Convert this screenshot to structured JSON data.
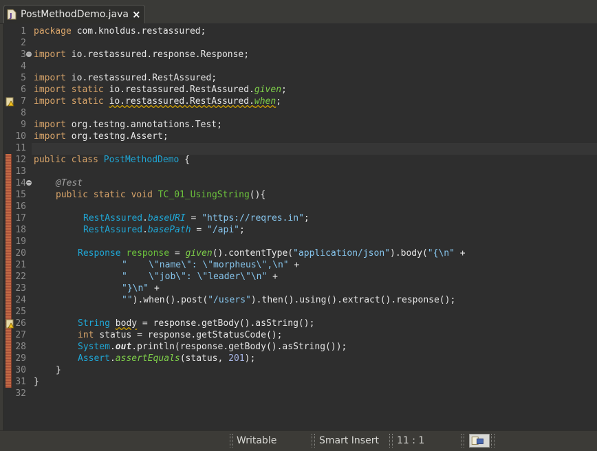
{
  "tab": {
    "title": "PostMethodDemo.java",
    "close": "×",
    "icon": "java-file-icon"
  },
  "editor": {
    "lines": [
      {
        "n": "1"
      },
      {
        "n": "2"
      },
      {
        "n": "3"
      },
      {
        "n": "4"
      },
      {
        "n": "5"
      },
      {
        "n": "6"
      },
      {
        "n": "7"
      },
      {
        "n": "8"
      },
      {
        "n": "9"
      },
      {
        "n": "10"
      },
      {
        "n": "11"
      },
      {
        "n": "12"
      },
      {
        "n": "13"
      },
      {
        "n": "14"
      },
      {
        "n": "15"
      },
      {
        "n": "16"
      },
      {
        "n": "17"
      },
      {
        "n": "18"
      },
      {
        "n": "19"
      },
      {
        "n": "20"
      },
      {
        "n": "21"
      },
      {
        "n": "22"
      },
      {
        "n": "23"
      },
      {
        "n": "24"
      },
      {
        "n": "25"
      },
      {
        "n": "26"
      },
      {
        "n": "27"
      },
      {
        "n": "28"
      },
      {
        "n": "29"
      },
      {
        "n": "30"
      },
      {
        "n": "31"
      },
      {
        "n": "32"
      }
    ],
    "code": {
      "l1_kw": "package",
      "l1_rest": " com.knoldus.restassured;",
      "l3_kw": "import",
      "l3_rest": " io.restassured.response.Response;",
      "l5_kw": "import",
      "l5_rest": " io.restassured.RestAssured;",
      "l6_kw": "import static",
      "l6_rest": " io.restassured.RestAssured.",
      "l6_m": "given",
      "l6_end": ";",
      "l7_kw": "import static",
      "l7_sp": " ",
      "l7_rest": "io.restassured.RestAssured.",
      "l7_m": "when",
      "l7_end": ";",
      "l9_kw": "import",
      "l9_rest": " org.testng.annotations.Test;",
      "l10_kw": "import",
      "l10_rest": " org.testng.Assert;",
      "l12_kw": "public class",
      "l12_sp": " ",
      "l12_cls": "PostMethodDemo",
      "l12_end": " {",
      "l14_ann": "@Test",
      "l15_kw": "public static void",
      "l15_sp": " ",
      "l15_m": "TC_01_UsingString",
      "l15_end": "(){",
      "l17_cls": "RestAssured",
      "l17_dot": ".",
      "l17_f": "baseURI",
      "l17_eq": " = ",
      "l17_str": "\"https://reqres.in\"",
      "l17_end": ";",
      "l18_cls": "RestAssured",
      "l18_dot": ".",
      "l18_f": "basePath",
      "l18_eq": " = ",
      "l18_str": "\"/api\"",
      "l18_end": ";",
      "l20_cls": "Response",
      "l20_sp": " ",
      "l20_var": "response",
      "l20_eq": " = ",
      "l20_m": "given",
      "l20_a": "().contentType(",
      "l20_s1": "\"application/json\"",
      "l20_b": ").body(",
      "l20_s2": "\"{\\n\"",
      "l20_end": " +",
      "l21_str": "\"    \\\"name\\\": \\\"morpheus\\\",\\n\"",
      "l21_end": " +",
      "l22_str": "\"    \\\"job\\\": \\\"leader\\\"\\n\"",
      "l22_end": " +",
      "l23_str": "\"}\\n\"",
      "l23_end": " +",
      "l24_str": "\"\"",
      "l24_a": ").when().post(",
      "l24_s": "\"/users\"",
      "l24_end": ").then().using().extract().response();",
      "l26_cls": "String",
      "l26_sp": " ",
      "l26_var": "body",
      "l26_end": " = response.getBody().asString();",
      "l27_kw": "int",
      "l27_sp": " ",
      "l27_var": "status",
      "l27_end": " = response.getStatusCode();",
      "l28_cls": "System",
      "l28_dot": ".",
      "l28_f": "out",
      "l28_end": ".println(response.getBody().asString());",
      "l29_cls": "Assert",
      "l29_dot": ".",
      "l29_m": "assertEquals",
      "l29_a": "(status, ",
      "l29_num": "201",
      "l29_end": ");",
      "l30": "}",
      "l31": "}"
    }
  },
  "status": {
    "writable": "Writable",
    "insert_mode": "Smart Insert",
    "position": "11 : 1",
    "icon": "task-icon"
  },
  "colors": {
    "background": "#2e2e2e",
    "keyword": "#d9a56a",
    "class": "#1fa7d6",
    "string": "#87c6ee",
    "method": "#6cc33c"
  }
}
